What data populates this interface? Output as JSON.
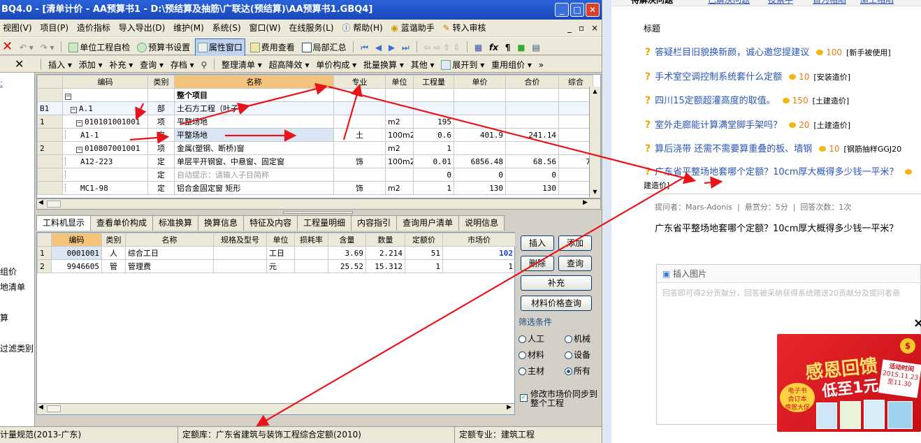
{
  "app": {
    "title": "BQ4.0 - [清单计价 - AA预算书1 - D:\\预结算及抽筋\\广联达(预结算)\\AA预算书1.GBQ4]",
    "menus": [
      "视图(V)",
      "项目(P)",
      "造价指标",
      "导入导出(D)",
      "维护(M)",
      "系统(S)",
      "窗口(W)",
      "在线服务(L)",
      "帮助(H)",
      "蓝谐助手",
      "转入审核"
    ],
    "mdi_controls": [
      "_",
      "▫",
      "×"
    ]
  },
  "toolbar1": {
    "items": [
      "单位工程自检",
      "预算书设置",
      "属性窗口",
      "费用查看",
      "局部汇总"
    ]
  },
  "toolbar2": {
    "items": [
      "插入",
      "添加",
      "补充",
      "查询",
      "存档",
      "整理清单",
      "超高降效",
      "单价构成",
      "批量换算",
      "其他",
      "展开到",
      "重用组价"
    ]
  },
  "leftpanel": {
    "items": [
      "组价",
      "地清单",
      "算",
      "过滤类别"
    ]
  },
  "grid1": {
    "headers": [
      "编码",
      "类别",
      "名称",
      "专业",
      "单位",
      "工程量",
      "单价",
      "合价",
      "综合"
    ],
    "rows": [
      {
        "rn": "",
        "code": "",
        "type": "",
        "name": "整个项目",
        "spec": "",
        "unit": "",
        "qty": "",
        "price": "",
        "total": "",
        "comp": ""
      },
      {
        "rn": "B1",
        "code": "A.1",
        "type": "部",
        "name": "土石方工程（叶子）",
        "spec": "",
        "unit": "",
        "qty": "",
        "price": "",
        "total": "",
        "comp": ""
      },
      {
        "rn": "1",
        "code": "010101001001",
        "type": "项",
        "name": "平整场地",
        "spec": "",
        "unit": "m2",
        "qty": "195",
        "price": "",
        "total": "",
        "comp": ""
      },
      {
        "rn": "",
        "code": "A1-1",
        "type": "定",
        "name": "平整场地",
        "spec": "土",
        "unit": "100m2",
        "qty": "0.6",
        "price": "401.9",
        "total": "241.14",
        "comp": ""
      },
      {
        "rn": "2",
        "code": "010807001001",
        "type": "项",
        "name": "金属(塑钢、断桥)窗",
        "spec": "",
        "unit": "m2",
        "qty": "1",
        "price": "",
        "total": "",
        "comp": ""
      },
      {
        "rn": "",
        "code": "A12-223",
        "type": "定",
        "name": "单层平开钢窗、中悬窗、固定窗",
        "spec": "饰",
        "unit": "100m2",
        "qty": "0.01",
        "price": "6856.48",
        "total": "68.56",
        "comp": "7"
      },
      {
        "rn": "",
        "code": "",
        "type": "定",
        "name": "自动提示：请输入子目简称",
        "spec": "",
        "unit": "",
        "qty": "0",
        "price": "0",
        "total": "0",
        "comp": ""
      },
      {
        "rn": "",
        "code": "MC1-98",
        "type": "定",
        "name": "铝合金固定窗 矩形",
        "spec": "饰",
        "unit": "m2",
        "qty": "1",
        "price": "130",
        "total": "130",
        "comp": ""
      }
    ]
  },
  "tabs": [
    "工料机显示",
    "查看单价构成",
    "标准换算",
    "换算信息",
    "特征及内容",
    "工程量明细",
    "内容指引",
    "查询用户清单",
    "说明信息"
  ],
  "grid2": {
    "headers": [
      "编码",
      "类别",
      "名称",
      "规格及型号",
      "单位",
      "损耗率",
      "含量",
      "数量",
      "定额价",
      "市场价"
    ],
    "rows": [
      {
        "rn": "1",
        "code": "0001001",
        "type": "人",
        "name": "综合工日",
        "spec": "",
        "unit": "工日",
        "loss": "",
        "content": "3.69",
        "qty": "2.214",
        "quota": "51",
        "market": "102"
      },
      {
        "rn": "2",
        "code": "9946605",
        "type": "管",
        "name": "管理费",
        "spec": "",
        "unit": "元",
        "loss": "",
        "content": "25.52",
        "qty": "15.312",
        "quota": "1",
        "market": "1"
      }
    ]
  },
  "side_buttons": {
    "insert": "插入",
    "add": "添加",
    "delete": "删除",
    "query": "查询",
    "supplement": "补充",
    "price_query": "材料价格查询"
  },
  "filter": {
    "title": "筛选条件",
    "options": [
      "人工",
      "机械",
      "材料",
      "设备",
      "主材",
      "所有"
    ],
    "selected": "所有",
    "sync_label": "修改市场价同步到整个工程"
  },
  "status": {
    "spec": "计量规范(2013-广东)",
    "quota_lib": "定额库：广东省建筑与装饰工程综合定额(2010)",
    "quota_major": "定额专业：建筑工程"
  },
  "qa": {
    "tab_labels": [
      "待解决问题",
      "已解决问题",
      "投票中",
      "自为相陷",
      "施工相陷"
    ],
    "header": "标题",
    "questions": [
      {
        "title": "答疑栏目旧貌换新颜，诚心邀您提建议",
        "score": "100",
        "tag": "[新手被使用]"
      },
      {
        "title": "手术室空调控制系统套什么定额",
        "score": "10",
        "tag": "[安装造价]"
      },
      {
        "title": "四川15定额超灌高度的取值。",
        "score": "150",
        "tag": "[土建造价]"
      },
      {
        "title": "室外走廊能计算满堂脚手架吗？",
        "score": "20",
        "tag": "[土建造价]"
      },
      {
        "title": "算后浇带 还需不需要算重叠的板、墙钢",
        "score": "10",
        "tag": "[钢筋抽样GGJ20"
      },
      {
        "title": "广东省平整场地套哪个定额？10cm厚大概得多少钱一平米？",
        "score": "",
        "tag": ""
      }
    ],
    "wrap_tag": "建造价]",
    "meta": "提问者：Mars-Adonis  |  悬赏分：5分  |  回答次数：1次",
    "question_full": "广东省平整场地套哪个定额？10cm厚大概得多少钱一平米？",
    "insert_image": "插入图片",
    "answer_placeholder": "回答即可得2分贡献分，回答被采纳获得系统赠送20贡献分及提问者悬",
    "ad_title": "感恩回馈",
    "ad_sub": "低至1元",
    "ad_badge1": "电子书",
    "ad_badge2": "合订本",
    "ad_badge3": "感恩大促",
    "ad_event": "活动时间",
    "ad_dates": "2015.11.23至11.30",
    "close": "×"
  }
}
